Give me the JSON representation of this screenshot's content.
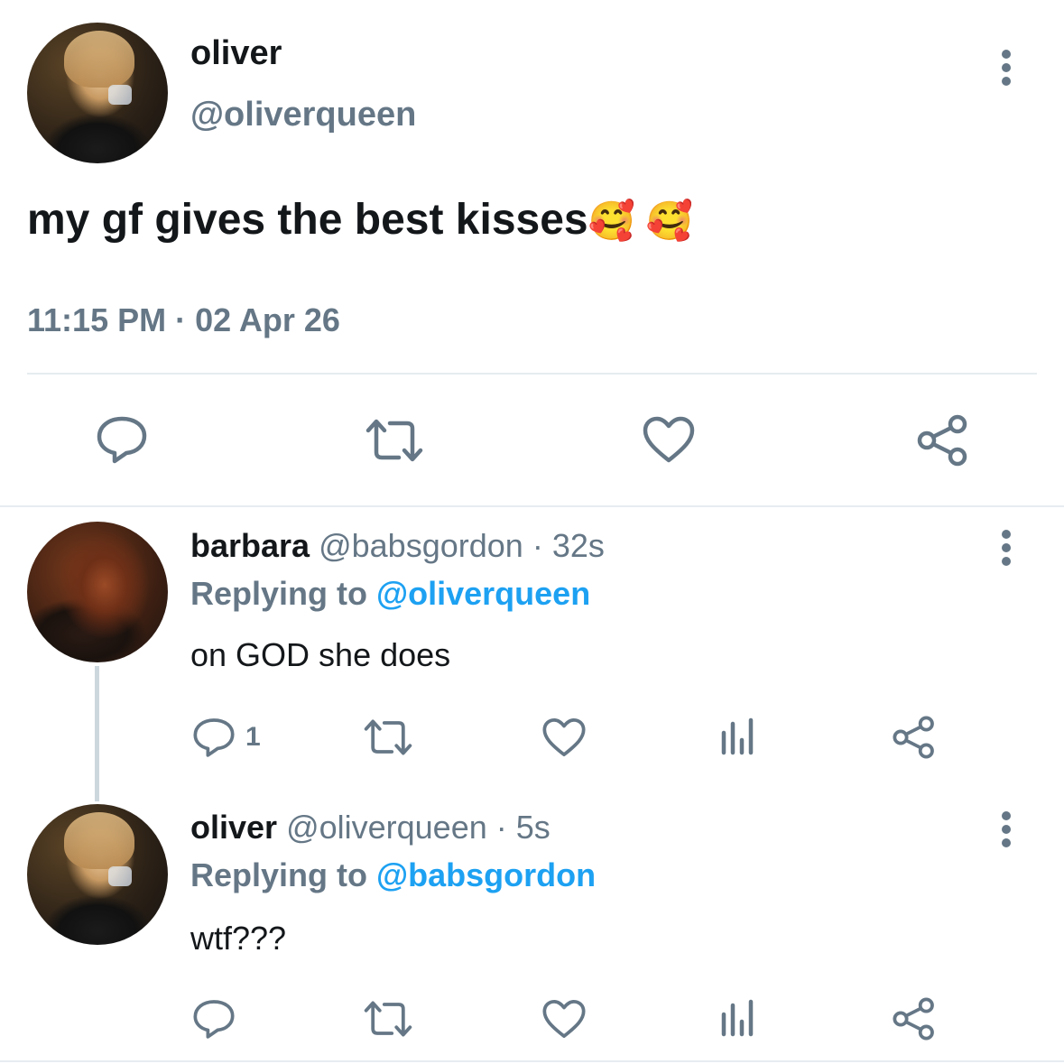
{
  "main_tweet": {
    "name": "oliver",
    "handle": "@oliverqueen",
    "text": "my gf gives the best kisses",
    "emoji": "🥰 🥰",
    "time": "11:15 PM",
    "separator": "·",
    "date": "02 Apr 26"
  },
  "replies": [
    {
      "name": "barbara",
      "handle": "@babsgordon",
      "dot": "·",
      "age": "32s",
      "replying_prefix": "Replying to",
      "replying_to": "@oliverqueen",
      "text": "on GOD she does",
      "reply_count": "1"
    },
    {
      "name": "oliver",
      "handle": "@oliverqueen",
      "dot": "·",
      "age": "5s",
      "replying_prefix": "Replying to",
      "replying_to": "@babsgordon",
      "text": "wtf???",
      "reply_count": ""
    }
  ],
  "icons": {
    "reply": "reply-icon",
    "retweet": "retweet-icon",
    "like": "heart-icon",
    "analytics": "analytics-icon",
    "share": "share-icon",
    "more": "more-icon"
  },
  "colors": {
    "text": "#14171a",
    "secondary": "#657786",
    "link": "#1da1f2",
    "divider": "#e6ecf0",
    "thread_line": "#ccd6dd"
  }
}
